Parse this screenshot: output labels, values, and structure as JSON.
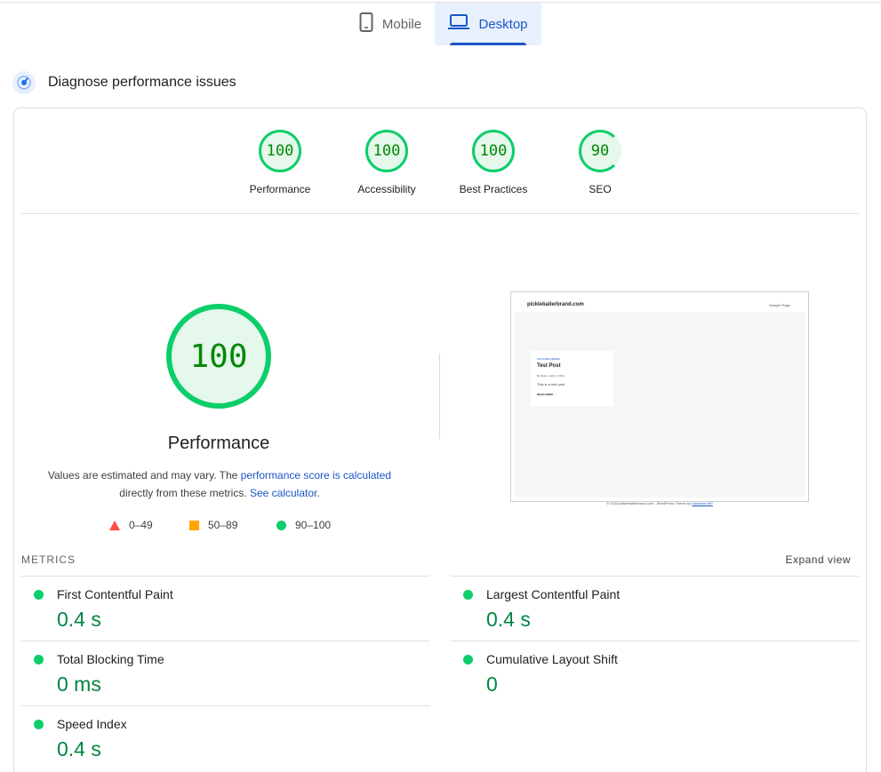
{
  "tabs": {
    "mobile": "Mobile",
    "desktop": "Desktop"
  },
  "diagnose": {
    "title": "Diagnose performance issues"
  },
  "scores": [
    {
      "value": "100",
      "label": "Performance"
    },
    {
      "value": "100",
      "label": "Accessibility"
    },
    {
      "value": "100",
      "label": "Best Practices"
    },
    {
      "value": "90",
      "label": "SEO"
    }
  ],
  "performance": {
    "score": "100",
    "label": "Performance",
    "desc_1": "Values are estimated and may vary. The ",
    "desc_link1": "performance score is calculated",
    "desc_2": "directly from these metrics. ",
    "desc_link2": "See calculator",
    "desc_3": "."
  },
  "legend": {
    "fail": "0–49",
    "average": "50–89",
    "pass": "90–100"
  },
  "screenshot": {
    "site": "pickleballerbrand.com",
    "nav": "Sample Page",
    "post_category": "UNCATEGORIZED",
    "post_title": "Test Post",
    "post_meta": "By Ryan  •  April 1, 2024",
    "post_excerpt": "This is a test post.",
    "post_more": "READ MORE →",
    "footer_text": "© 2024 pickleballerbrand.com - WordPress Theme by ",
    "footer_link": "Kadence WP"
  },
  "metrics": {
    "title": "METRICS",
    "expand": "Expand view",
    "items": [
      {
        "name": "First Contentful Paint",
        "value": "0.4 s"
      },
      {
        "name": "Largest Contentful Paint",
        "value": "0.4 s"
      },
      {
        "name": "Total Blocking Time",
        "value": "0 ms"
      },
      {
        "name": "Cumulative Layout Shift",
        "value": "0"
      },
      {
        "name": "Speed Index",
        "value": "0.4 s"
      }
    ]
  },
  "colors": {
    "pass": "#0cce6b",
    "average": "#ffa400",
    "fail": "#ff4e42",
    "accent": "#1a56c6",
    "metric_value": "#018642"
  }
}
